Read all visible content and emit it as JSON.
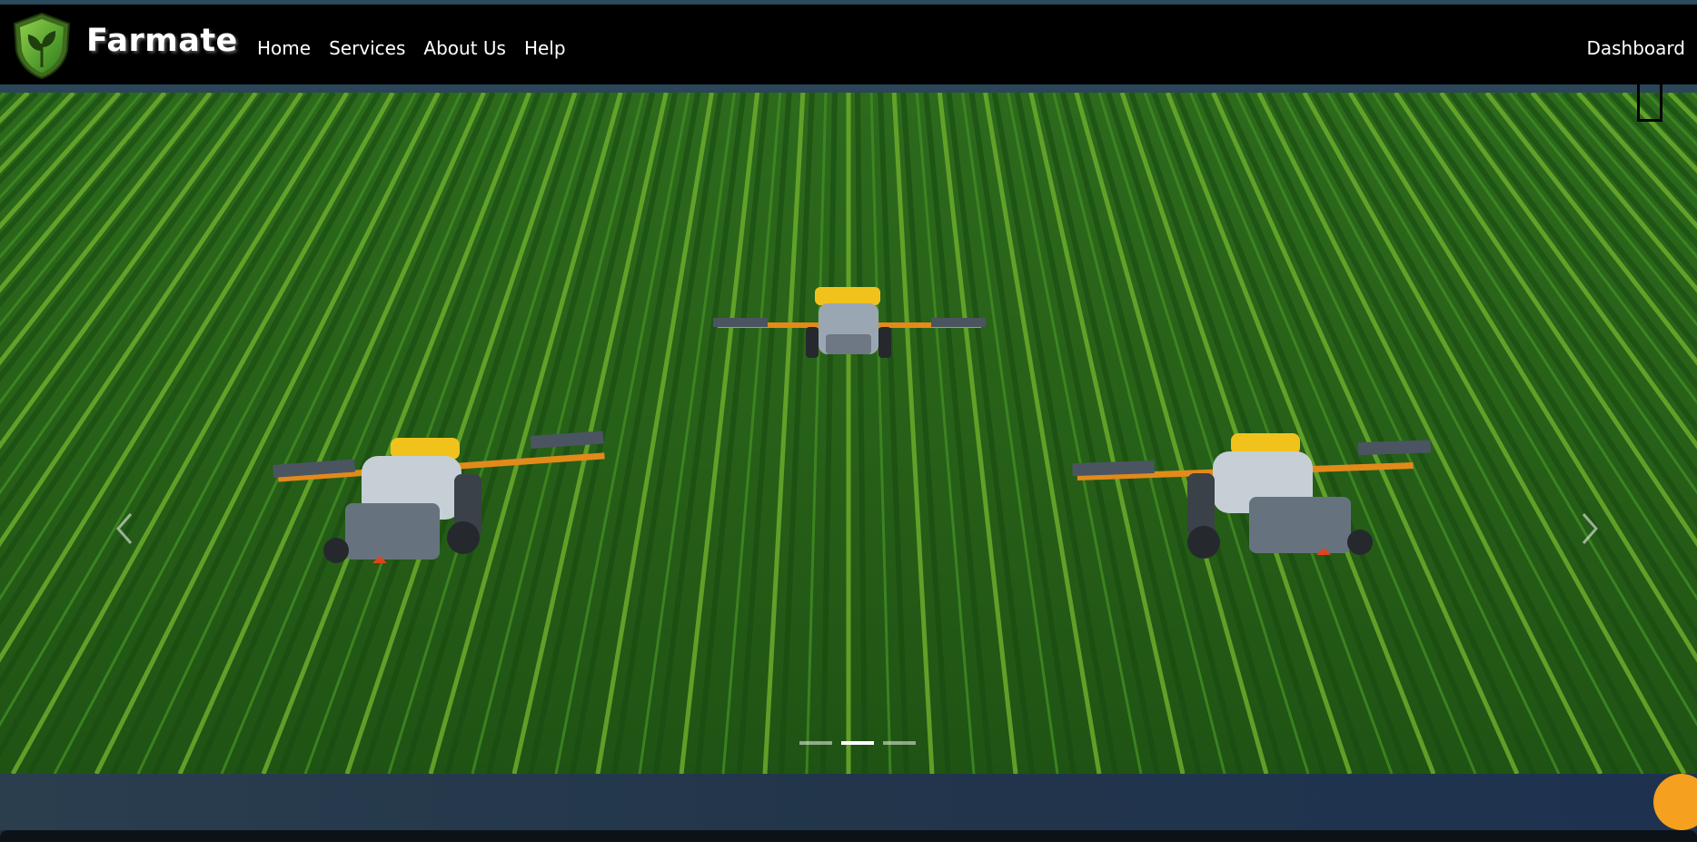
{
  "app": {
    "brand": "Farmate"
  },
  "nav": {
    "links": [
      "Home",
      "Services",
      "About Us",
      "Help"
    ],
    "dashboard": "Dashboard"
  },
  "carousel": {
    "slide_count": 3,
    "active_index": 1
  },
  "colors": {
    "navbar_bg": "#000000",
    "accent_orange": "#f5a01e",
    "field_green": "#2f6a1d",
    "footer_band": "#22354b"
  },
  "icons": {
    "logo": "shield-leaf-icon",
    "prev": "chevron-left-icon",
    "next": "chevron-right-icon"
  }
}
